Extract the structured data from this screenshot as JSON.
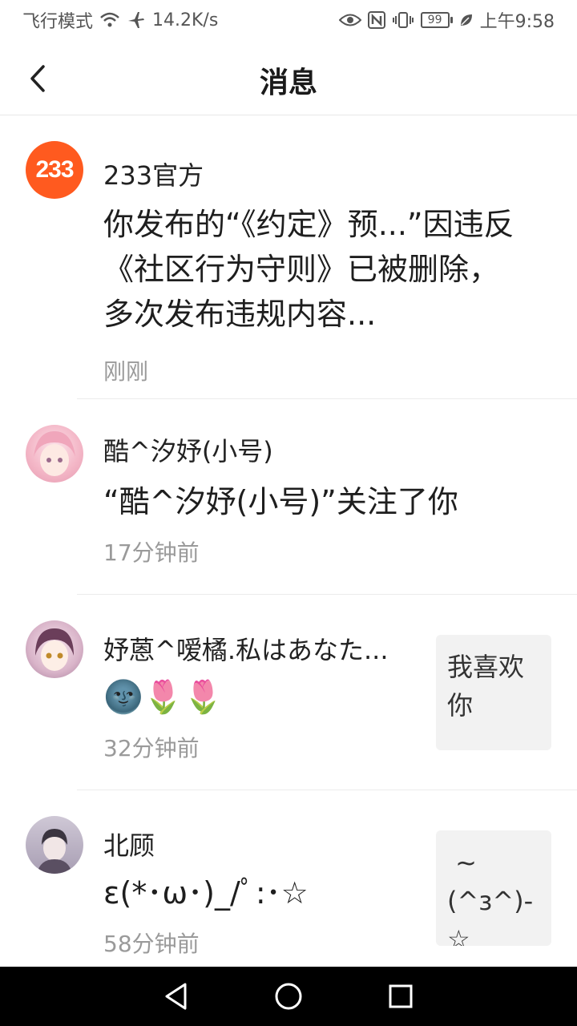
{
  "status_bar": {
    "airplane_label": "飞行模式",
    "wifi_icon": "wifi-icon",
    "airplane_icon": "airplane-icon",
    "speed": "14.2K/s",
    "eye_icon": "eye-icon",
    "nfc_icon": "nfc-icon",
    "vibrate_icon": "vibrate-icon",
    "battery": "99",
    "leaf_icon": "leaf-icon",
    "time": "上午9:58"
  },
  "header": {
    "back_icon": "chevron-left-icon",
    "title": "消息"
  },
  "messages": [
    {
      "avatar_text": "233",
      "avatar_color": "#ff5a1f",
      "name": "233官方",
      "text": "你发布的“《约定》预...”因违反《社区行为守则》已被删除，多次发布违规内容...",
      "time": "刚刚"
    },
    {
      "name": "酷^汐妤(小号)",
      "text": "“酷^汐妤(小号)”关注了你",
      "time": "17分钟前"
    },
    {
      "name": "妤蒽^嗳橘.私はあなた...",
      "text": "🌚🌷🌷",
      "time": "32分钟前",
      "thumb": "我喜欢你"
    },
    {
      "name": "北顾",
      "text": "ε(*･ω･)_/ﾟ:･☆",
      "time": "58分钟前",
      "thumb": " ~ (^з^)-☆"
    }
  ],
  "nav": {
    "back_icon": "triangle-back-icon",
    "home_icon": "circle-home-icon",
    "recents_icon": "square-recents-icon"
  },
  "colors": {
    "accent": "#ff5a1f",
    "navbar": "#000000"
  }
}
